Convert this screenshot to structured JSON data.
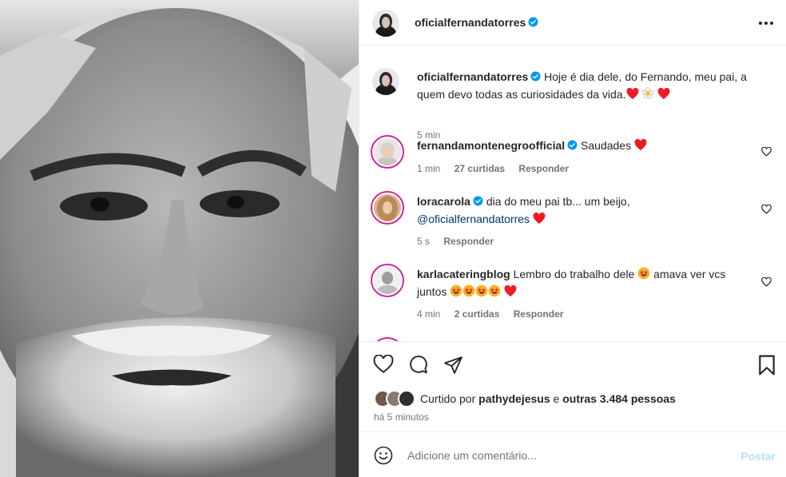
{
  "post": {
    "author": "oficialfernandatorres",
    "caption_rest": "Hoje é dia dele, do Fernando, meu pai, a quem devo todas as curiosidades da vida.",
    "caption_time": "5 min"
  },
  "comments": [
    {
      "user": "fernandamontenegroofficial",
      "verified": true,
      "text": "Saudades",
      "time": "1 min",
      "likes": "27 curtidas",
      "reply": "Responder"
    },
    {
      "user": "loracarola",
      "verified": true,
      "text": "dia do meu pai tb... um beijo,",
      "mention": "@oficialfernandatorres",
      "time": "5 s",
      "reply": "Responder"
    },
    {
      "user": "karlacateringblog",
      "verified": false,
      "text_a": "Lembro do trabalho dele",
      "text_b": "amava ver vcs",
      "text_c": "juntos",
      "time": "4 min",
      "likes": "2 curtidas",
      "reply": "Responder"
    }
  ],
  "likes": {
    "prefix": "Curtido por",
    "user": "pathydejesus",
    "middle": "e",
    "others": "outras 3.484 pessoas"
  },
  "posted_ago": "há 5 minutos",
  "add_comment": {
    "placeholder": "Adicione um comentário...",
    "post_label": "Postar"
  },
  "colors": {
    "verified": "#0095f6",
    "heart": "#ed1c24",
    "mention": "#00376b",
    "story_ring": "#d6249f",
    "post_disabled": "#b2dffc"
  }
}
